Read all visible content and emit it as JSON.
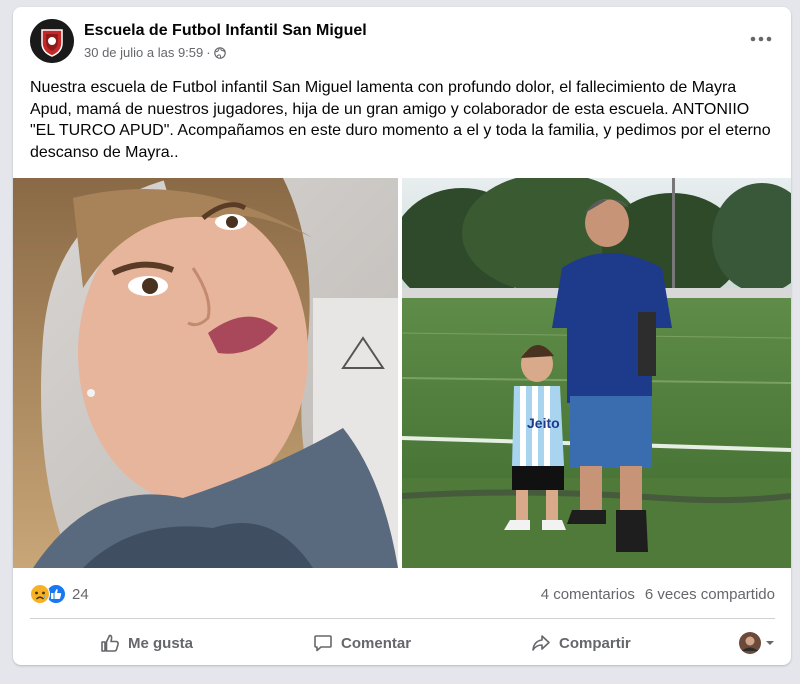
{
  "post": {
    "page_name": "Escuela de Futbol Infantil San Miguel",
    "timestamp": "30 de julio a las 9:59",
    "separator": "·",
    "audience_icon": "globe-icon",
    "text": "Nuestra escuela de Futbol infantil San Miguel lamenta con profundo dolor, el fallecimiento de Mayra Apud, mamá de nuestros jugadores, hija de un gran amigo y colaborador de esta escuela. ANTONIIO \"EL TURCO APUD\". Acompañamos en este duro momento a el y toda la familia, y pedimos por el eterno descanso de Mayra.."
  },
  "photos": {
    "left": {
      "shirt_text": ""
    },
    "right": {
      "shirt_text": "Jeito"
    }
  },
  "stats": {
    "reaction_icons": [
      "sad-reaction-icon",
      "like-reaction-icon"
    ],
    "reaction_count": "24",
    "comments": "4 comentarios",
    "shares": "6 veces compartido"
  },
  "actions": {
    "like": "Me gusta",
    "comment": "Comentar",
    "share": "Compartir"
  },
  "colors": {
    "like_blue": "#1877f2",
    "sad_yellow": "#f7b125",
    "text_primary": "#050505",
    "text_secondary": "#65676b"
  }
}
